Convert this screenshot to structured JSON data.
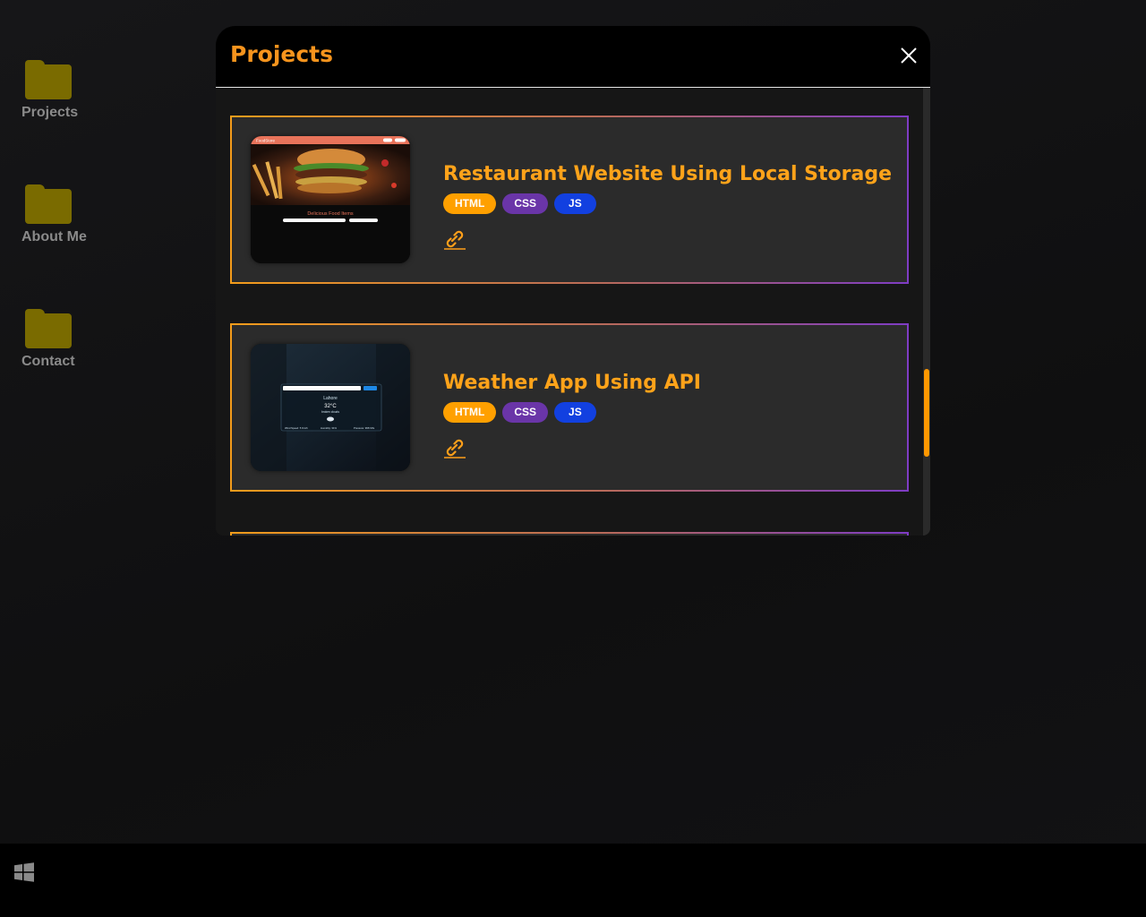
{
  "desktop": {
    "icons": [
      {
        "label": "Projects"
      },
      {
        "label": "About Me"
      },
      {
        "label": "Contact"
      }
    ]
  },
  "modal": {
    "title": "Projects",
    "projects": [
      {
        "title": "Restaurant Website Using Local Storage",
        "tags": [
          "HTML",
          "CSS",
          "JS"
        ],
        "thumbnail": {
          "brand": "FoodStore",
          "heading": "Delicious Food Items"
        }
      },
      {
        "title": "Weather App Using API",
        "tags": [
          "HTML",
          "CSS",
          "JS"
        ],
        "thumbnail": {
          "city": "Lahore",
          "temperature": "32°C",
          "condition": "broken clouds",
          "wind": "Wind Speed: 5 Km/h",
          "humidity": "Humidity: 31%",
          "pressure": "Pressure: 998 hPa"
        }
      }
    ]
  },
  "colors": {
    "accent": "#ffa31a",
    "folder": "#7a6b00",
    "tag_html": "#ffa000",
    "tag_css": "#6a35a8",
    "tag_js": "#1240e0",
    "scroll_thumb": "#ff9800"
  },
  "icons": {
    "close": "close-icon",
    "link": "link-icon",
    "start": "windows-icon",
    "folder": "folder-icon"
  }
}
